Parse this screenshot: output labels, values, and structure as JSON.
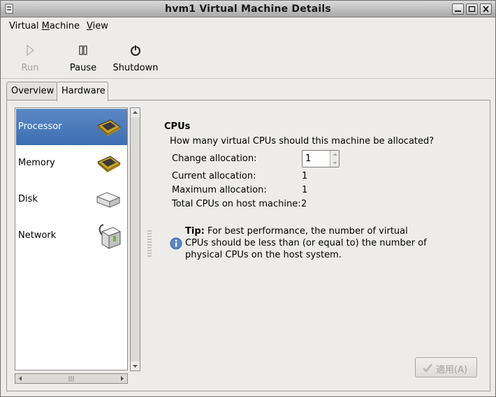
{
  "window": {
    "title": "hvm1 Virtual Machine Details"
  },
  "menubar": {
    "items": [
      {
        "pre": "Virtual ",
        "key": "M",
        "post": "achine"
      },
      {
        "pre": "",
        "key": "V",
        "post": "iew"
      }
    ]
  },
  "toolbar": {
    "run_label": "Run",
    "pause_label": "Pause",
    "shutdown_label": "Shutdown"
  },
  "tabs": [
    {
      "label": "Overview",
      "active": false
    },
    {
      "label": "Hardware",
      "active": true
    }
  ],
  "hardware_list": [
    {
      "label": "Processor",
      "icon": "processor-icon",
      "selected": true
    },
    {
      "label": "Memory",
      "icon": "memory-chip-icon",
      "selected": false
    },
    {
      "label": "Disk",
      "icon": "disk-icon",
      "selected": false
    },
    {
      "label": "Network",
      "icon": "network-card-icon",
      "selected": false
    }
  ],
  "cpus": {
    "heading": "CPUs",
    "question": "How many virtual CPUs should this machine be allocated?",
    "change_label": "Change allocation:",
    "change_value": "1",
    "current_label": "Current allocation:",
    "current_value": "1",
    "maximum_label": "Maximum allocation:",
    "maximum_value": "1",
    "total_label": "Total CPUs on host machine:",
    "total_value": "2",
    "tip_bold": "Tip:",
    "tip_lines": [
      " For best performance, the number of virtual",
      "CPUs should be less than (or equal to) the number of",
      "physical CPUs on the host system."
    ],
    "apply_label": "適用(A)"
  },
  "colors": {
    "selection": "#4a78b8",
    "window_bg": "#edeceb",
    "titlebar": "#bdbdbd",
    "disabled_text": "#a3a3a3"
  }
}
